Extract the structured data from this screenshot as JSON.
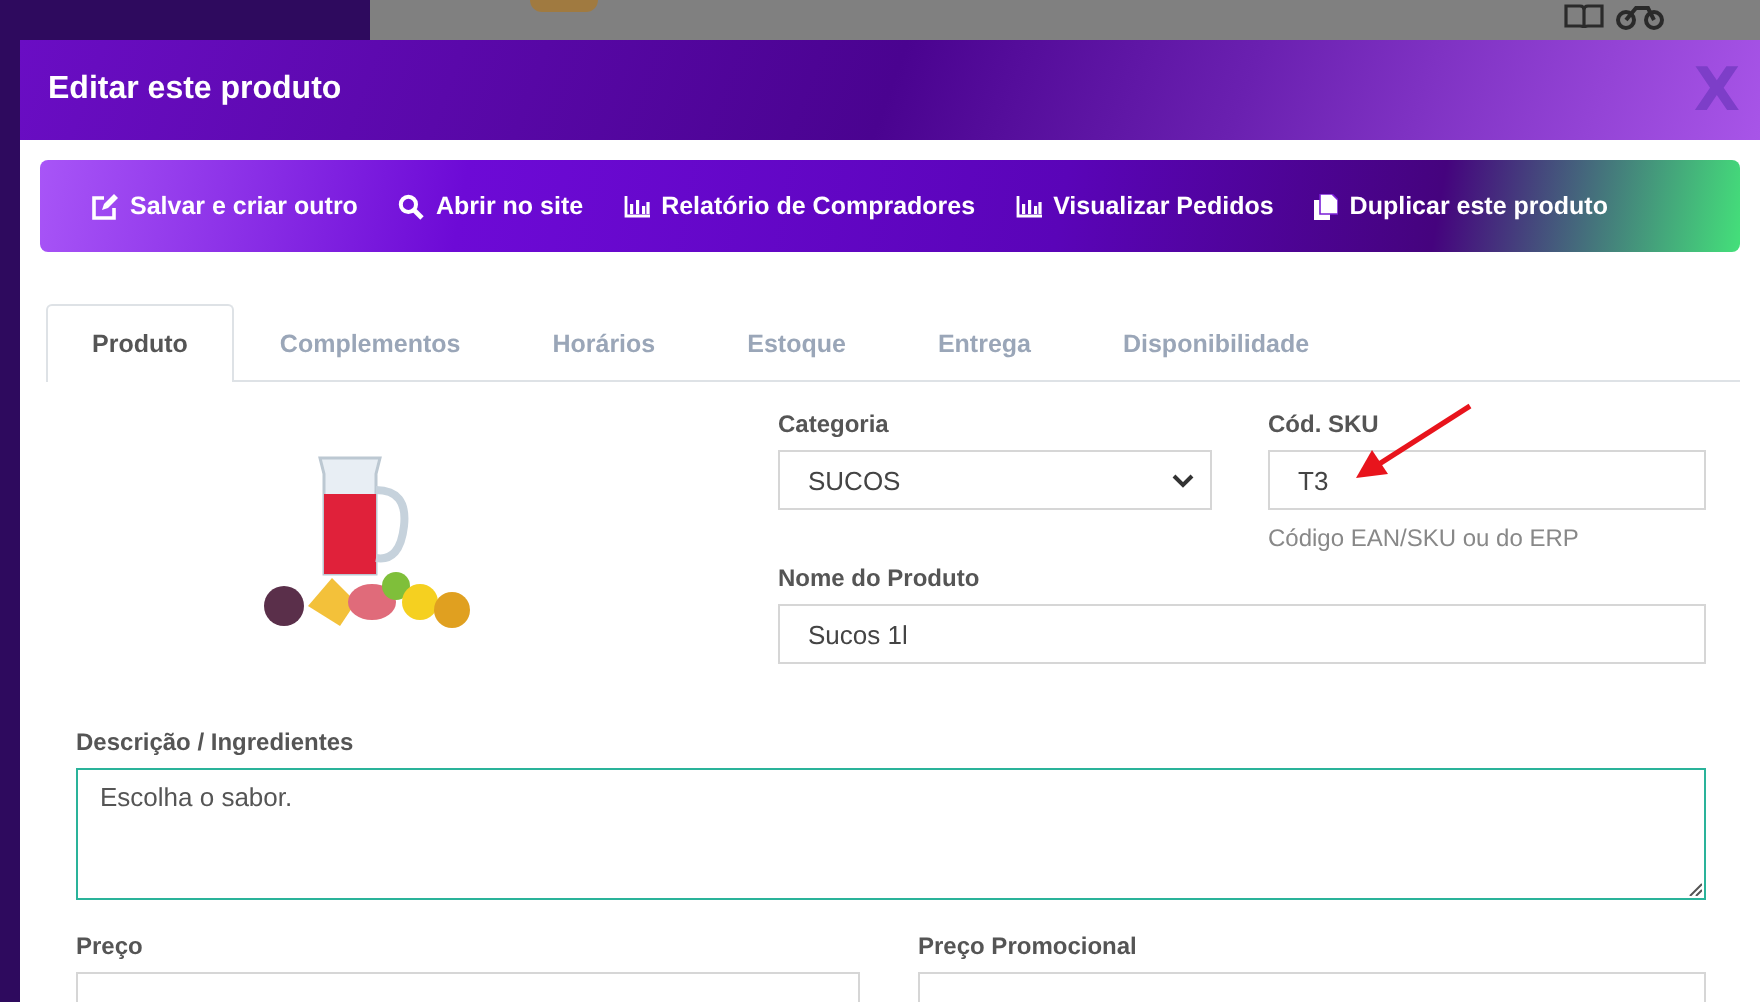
{
  "modal": {
    "title": "Editar este produto",
    "close": "X"
  },
  "toolbar": [
    {
      "kind": "edit",
      "label": "Salvar e criar outro"
    },
    {
      "kind": "search",
      "label": "Abrir no site"
    },
    {
      "kind": "chart",
      "label": "Relatório de Compradores"
    },
    {
      "kind": "chart",
      "label": "Visualizar Pedidos"
    },
    {
      "kind": "copy",
      "label": "Duplicar este produto"
    }
  ],
  "tabs": [
    {
      "label": "Produto",
      "selected": true
    },
    {
      "label": "Complementos",
      "selected": false
    },
    {
      "label": "Horários",
      "selected": false
    },
    {
      "label": "Estoque",
      "selected": false
    },
    {
      "label": "Entrega",
      "selected": false
    },
    {
      "label": "Disponibilidade",
      "selected": false
    }
  ],
  "form": {
    "category": {
      "label": "Categoria",
      "value": "SUCOS"
    },
    "sku": {
      "label": "Cód. SKU",
      "value": "T3",
      "help": "Código EAN/SKU ou do ERP"
    },
    "name": {
      "label": "Nome do Produto",
      "value": "Sucos 1l"
    },
    "description": {
      "label": "Descrição / Ingredientes",
      "value": "Escolha o sabor.",
      "focused": true
    },
    "price": {
      "label": "Preço"
    },
    "promo_price": {
      "label": "Preço Promocional"
    }
  }
}
